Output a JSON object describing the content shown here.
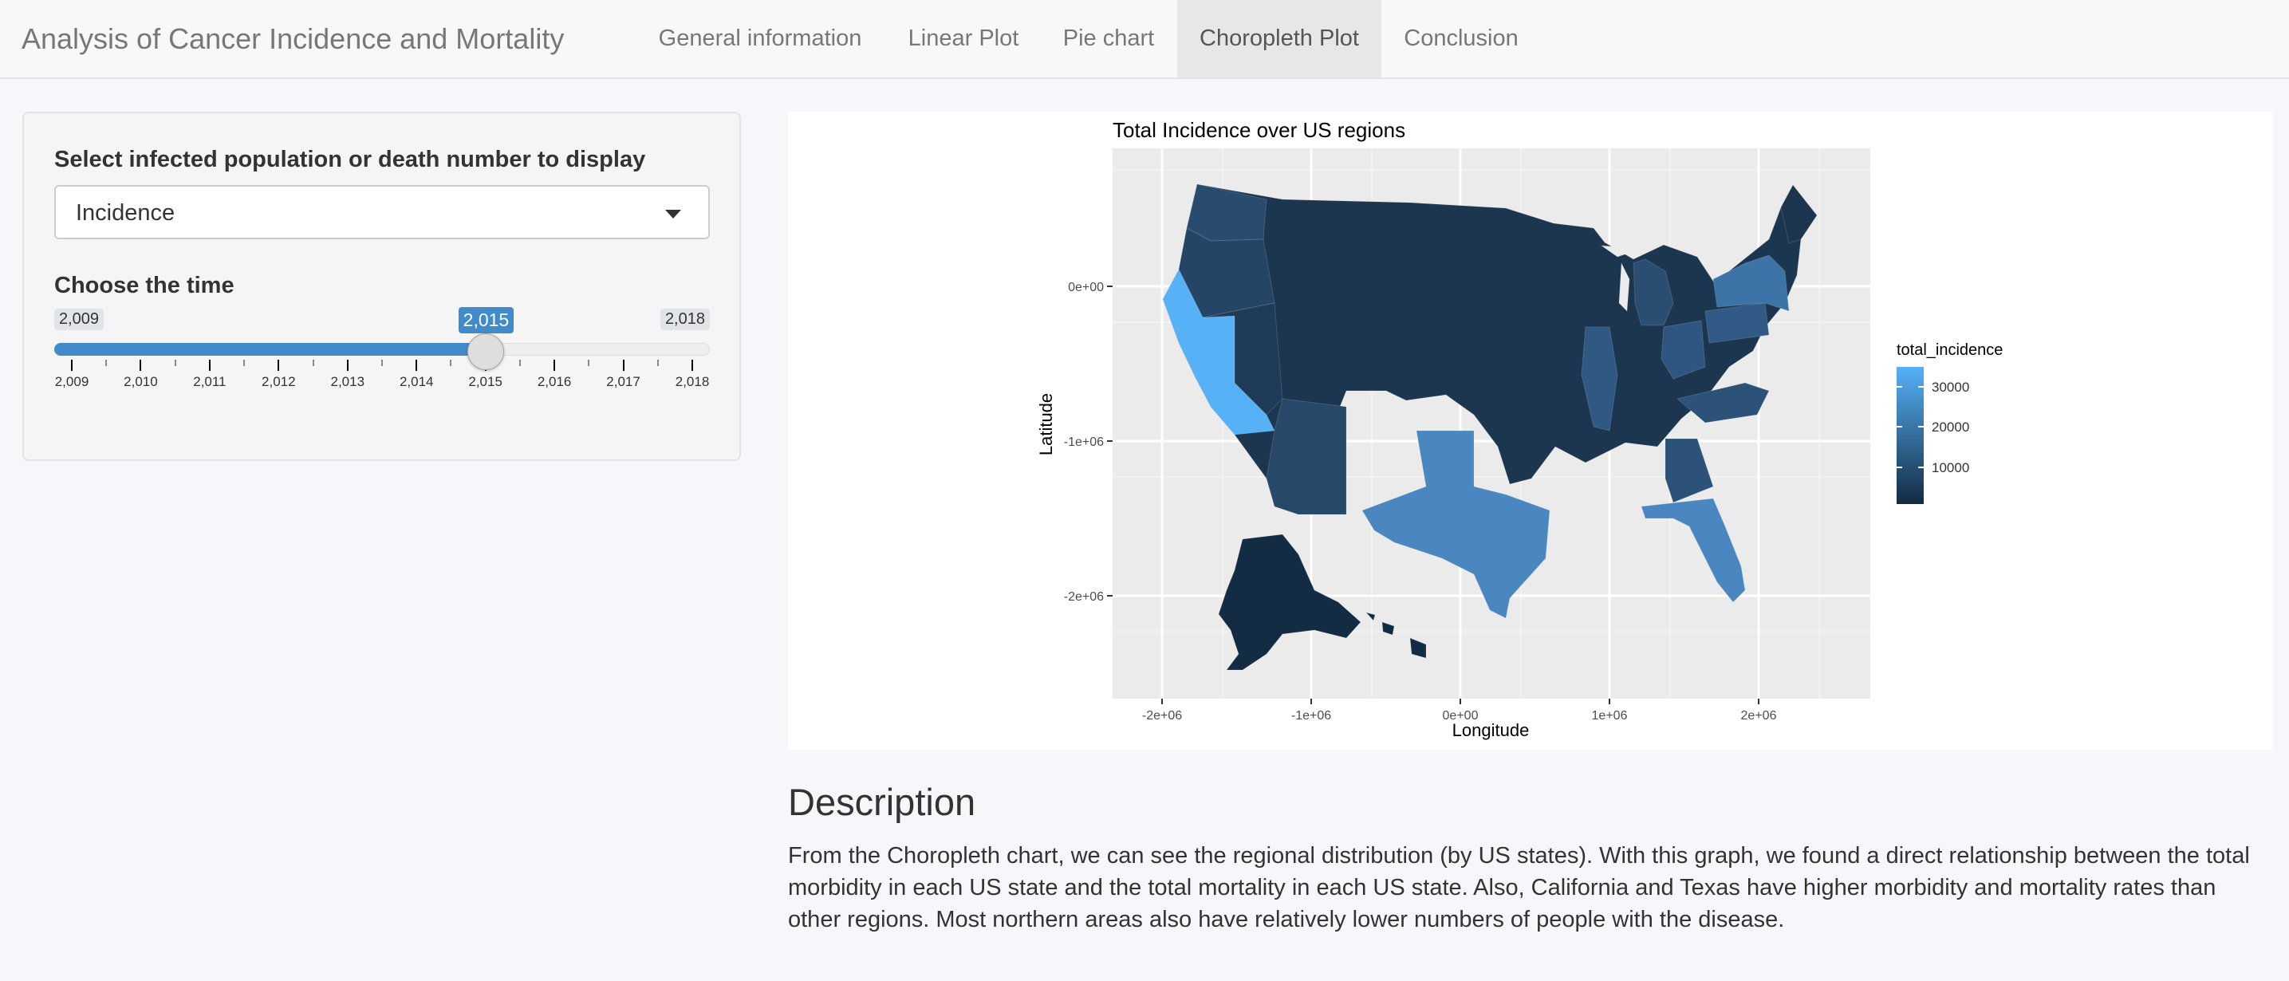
{
  "app": {
    "title": "Analysis of Cancer Incidence and Mortality",
    "tabs": [
      {
        "label": "General information"
      },
      {
        "label": "Linear Plot"
      },
      {
        "label": "Pie chart"
      },
      {
        "label": "Choropleth Plot"
      },
      {
        "label": "Conclusion"
      }
    ],
    "active_tab": "Choropleth Plot"
  },
  "sidebar": {
    "select_label": "Select infected population or death number to display",
    "select_value": "Incidence",
    "slider_label": "Choose the time",
    "slider": {
      "min_label": "2,009",
      "max_label": "2,018",
      "value_label": "2,015",
      "min": 2009,
      "max": 2018,
      "value": 2015,
      "tick_labels": [
        "2,009",
        "2,010",
        "2,011",
        "2,012",
        "2,013",
        "2,014",
        "2,015",
        "2,016",
        "2,017",
        "2,018"
      ]
    }
  },
  "chart_data": {
    "type": "choropleth",
    "title": "Total Incidence over US regions",
    "xlabel": "Longitude",
    "ylabel": "Latitude",
    "x_ticks": [
      "-2e+06",
      "-1e+06",
      "0e+00",
      "1e+06",
      "2e+06"
    ],
    "y_ticks": [
      "0e+00",
      "-1e+06",
      "-2e+06"
    ],
    "legend": {
      "title": "total_incidence",
      "labels": [
        "30000",
        "20000",
        "10000"
      ],
      "low_color": "#132b43",
      "high_color": "#56b1f7",
      "placement": "right"
    },
    "grid": true,
    "panel_background": "#ebebeb"
  },
  "description": {
    "title": "Description",
    "text": "From the Choropleth chart, we can see the regional distribution (by US states). With this graph, we found a direct relationship between the total morbidity in each US state and the total mortality in each US state. Also, California and Texas have higher morbidity and mortality rates than other regions. Most northern areas also have relatively lower numbers of people with the disease."
  }
}
